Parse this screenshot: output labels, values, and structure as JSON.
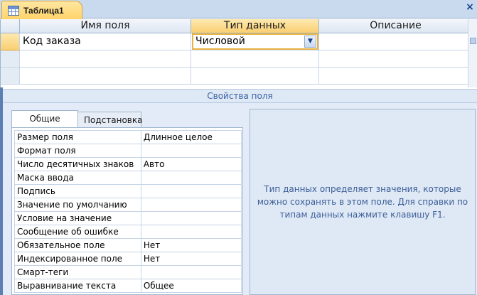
{
  "tab": {
    "title": "Таблица1",
    "icon": "table-icon",
    "close": "×"
  },
  "grid": {
    "headers": {
      "name": "Имя поля",
      "type": "Тип данных",
      "description": "Описание"
    },
    "rows": [
      {
        "name": "Код заказа",
        "type": "Числовой",
        "description": ""
      }
    ]
  },
  "properties_title": "Свойства поля",
  "property_tabs": {
    "general": "Общие",
    "lookup": "Подстановка"
  },
  "properties": [
    {
      "name": "Размер поля",
      "value": "Длинное целое"
    },
    {
      "name": "Формат поля",
      "value": ""
    },
    {
      "name": "Число десятичных знаков",
      "value": "Авто"
    },
    {
      "name": "Маска ввода",
      "value": ""
    },
    {
      "name": "Подпись",
      "value": ""
    },
    {
      "name": "Значение по умолчанию",
      "value": ""
    },
    {
      "name": "Условие на значение",
      "value": ""
    },
    {
      "name": "Сообщение об ошибке",
      "value": ""
    },
    {
      "name": "Обязательное поле",
      "value": "Нет"
    },
    {
      "name": "Индексированное поле",
      "value": "Нет"
    },
    {
      "name": "Смарт-теги",
      "value": ""
    },
    {
      "name": "Выравнивание текста",
      "value": "Общее"
    }
  ],
  "help_text": "Тип данных определяет значения, которые можно сохранять в этом поле.  Для справки по типам данных нажмите клавишу F1.",
  "colors": {
    "accent": "#f9cf72",
    "header": "#dde6f2",
    "panel": "#e2ebf7",
    "help_text": "#3b5f97"
  }
}
